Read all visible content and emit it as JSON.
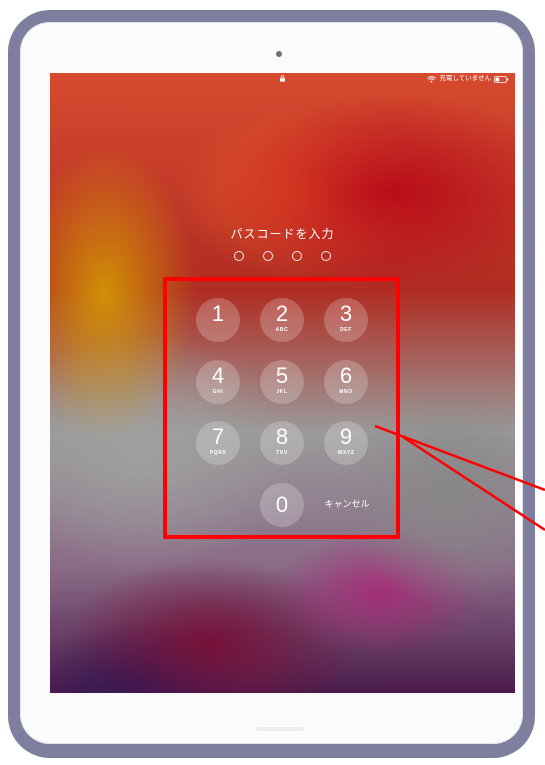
{
  "status_bar": {
    "wifi_icon": "wifi-icon",
    "lock_icon": "lock-icon",
    "charging_text": "充電していません",
    "battery_icon": "battery-icon"
  },
  "lock_screen": {
    "title": "パスコードを入力",
    "passcode_length": 4,
    "keys": [
      {
        "digit": "1",
        "letters": ""
      },
      {
        "digit": "2",
        "letters": "ABC"
      },
      {
        "digit": "3",
        "letters": "DEF"
      },
      {
        "digit": "4",
        "letters": "GHI"
      },
      {
        "digit": "5",
        "letters": "JKL"
      },
      {
        "digit": "6",
        "letters": "MNO"
      },
      {
        "digit": "7",
        "letters": "PQRS"
      },
      {
        "digit": "8",
        "letters": "TUV"
      },
      {
        "digit": "9",
        "letters": "WXYZ"
      },
      {
        "digit": "0",
        "letters": ""
      }
    ],
    "cancel_label": "キャンセル"
  },
  "colors": {
    "highlight": "#ff0000",
    "case": "#7e7f9e"
  }
}
